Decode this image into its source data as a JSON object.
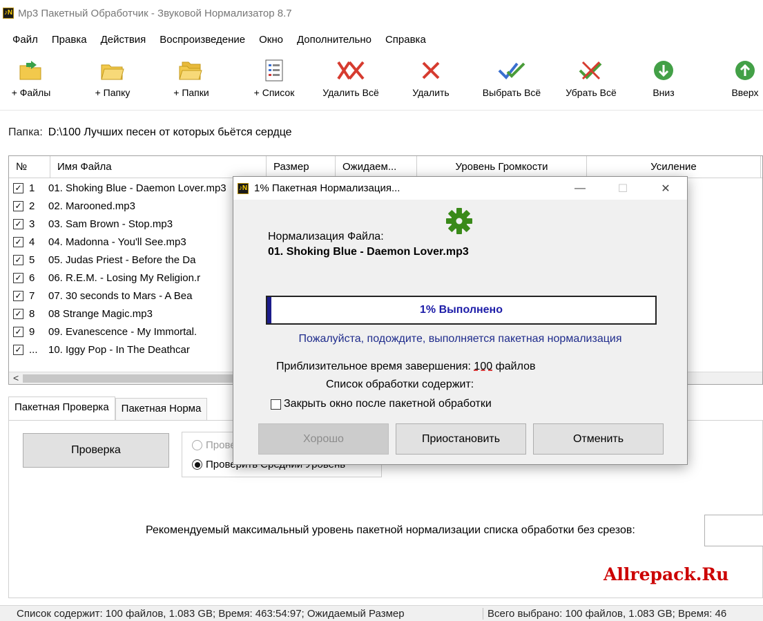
{
  "window": {
    "icon_text": "♪N",
    "title": "Mp3 Пакетный Обработчик - Звуковой Нормализатор 8.7"
  },
  "menu": [
    "Файл",
    "Правка",
    "Действия",
    "Воспроизведение",
    "Окно",
    "Дополнительно",
    "Справка"
  ],
  "toolbar": {
    "add_files": "+ Файлы",
    "add_folder": "+ Папку",
    "add_folders": "+ Папки",
    "add_list": "+ Список",
    "remove_all": "Удалить Всё",
    "remove": "Удалить",
    "select_all": "Выбрать Всё",
    "deselect_all": "Убрать Всё",
    "down": "Вниз",
    "up": "Вверх"
  },
  "folder": {
    "label": "Папка:",
    "path": "D:\\100 Лучших песен от которых бьётся сердце"
  },
  "table": {
    "headers": [
      "№",
      "Имя Файла",
      "Размер",
      "Ожидаем...",
      "Уровень Громкости",
      "Усиление"
    ],
    "rows": [
      {
        "num": "1",
        "name": "01. Shoking Blue - Daemon Lover.mp3",
        "checked": true
      },
      {
        "num": "2",
        "name": "02. Marooned.mp3",
        "checked": true
      },
      {
        "num": "3",
        "name": "03. Sam Brown - Stop.mp3",
        "checked": true
      },
      {
        "num": "4",
        "name": "04. Madonna - You'll See.mp3",
        "checked": true
      },
      {
        "num": "5",
        "name": "05. Judas Priest - Before the Da",
        "checked": true
      },
      {
        "num": "6",
        "name": "06. R.E.M. - Losing My Religion.r",
        "checked": true
      },
      {
        "num": "7",
        "name": "07. 30 seconds to Mars - A Bea",
        "checked": true
      },
      {
        "num": "8",
        "name": "08 Strange Magic.mp3",
        "checked": true
      },
      {
        "num": "9",
        "name": "09. Evanescence - My Immortal.",
        "checked": true
      },
      {
        "num": "...",
        "name": "10. Iggy Pop - In The Deathcar",
        "checked": true
      }
    ],
    "scroll_left": "<"
  },
  "tabs": [
    "Пакетная Проверка",
    "Пакетная Норма"
  ],
  "panel": {
    "check_button": "Проверка",
    "radio_1": "Проверить Пиковый Уровень",
    "radio_2": "Проверить Средний Уровень",
    "recommend_label": "Рекомендуемый максимальный уровень пакетной нормализации списка обработки без срезов:"
  },
  "watermark": "Allrepack.Ru",
  "status": {
    "left": "Список содержит: 100 файлов, 1.083 GB; Время: 463:54:97; Ожидаемый Размер",
    "right": "Всего выбрано: 100 файлов, 1.083 GB; Время: 46"
  },
  "dialog": {
    "title": "1% Пакетная Нормализация...",
    "file_label": "Нормализация Файла:",
    "file_name": "01. Shoking Blue - Daemon Lover.mp3",
    "progress_text": "1% Выполнено",
    "progress_fraction": 0.01,
    "wait_text": "Пожалуйста, подождите, выполняется пакетная нормализация",
    "eta_prefix": "Приблизительное время завершения:",
    "eta_number": "100",
    "eta_suffix": "файлов",
    "list_contains": "Список обработки содержит:",
    "close_option": "Закрыть окно после пакетной обработки",
    "ok_button": "Хорошо",
    "pause_button": "Приостановить",
    "cancel_button": "Отменить",
    "minimize": "—",
    "maximize": "☐",
    "close": "✕"
  },
  "colors": {
    "progress_fill": "#1c1c8a",
    "progress_text": "#1d1da8",
    "gear": "#3a8a1a",
    "watermark": "#cc0000"
  }
}
